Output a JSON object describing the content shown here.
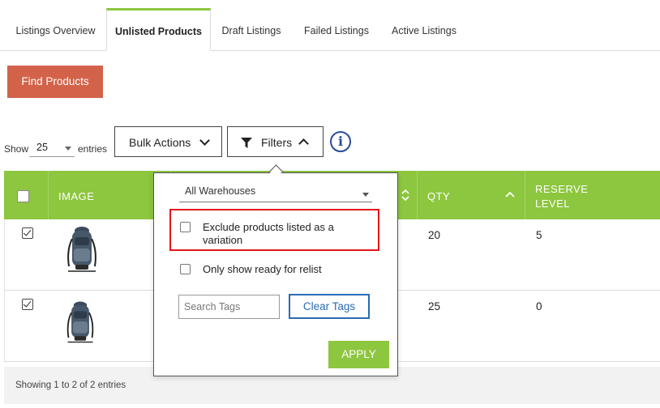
{
  "tabs": [
    {
      "label": "Listings Overview",
      "active": false
    },
    {
      "label": "Unlisted Products",
      "active": true
    },
    {
      "label": "Draft Listings",
      "active": false
    },
    {
      "label": "Failed Listings",
      "active": false
    },
    {
      "label": "Active Listings",
      "active": false
    }
  ],
  "find_button": "Find Products",
  "entries": {
    "show_label": "Show",
    "value": "25",
    "suffix": "entries"
  },
  "controls": {
    "bulk_actions": "Bulk Actions",
    "filters": "Filters"
  },
  "table": {
    "columns": [
      "IMAGE",
      "QTY",
      "RESERVE LEVEL"
    ],
    "reserve_line1": "RESERVE",
    "reserve_line2": "LEVEL",
    "rows": [
      {
        "checked": true,
        "qty": "20",
        "reserve": "5"
      },
      {
        "checked": true,
        "qty": "25",
        "reserve": "0"
      }
    ],
    "footer": "Showing 1 to 2 of 2 entries"
  },
  "filters": {
    "warehouse": "All Warehouses",
    "exclude_line1": "Exclude products listed as a",
    "exclude_line2": "variation",
    "ready_label": "Only show ready for relist",
    "tag_placeholder": "Search Tags",
    "clear_tags": "Clear Tags",
    "apply": "APPLY"
  },
  "colors": {
    "accent_green": "#8dc63f",
    "find_button": "#d2634a",
    "highlight": "#e3141b",
    "link_blue": "#2a6bb5"
  }
}
